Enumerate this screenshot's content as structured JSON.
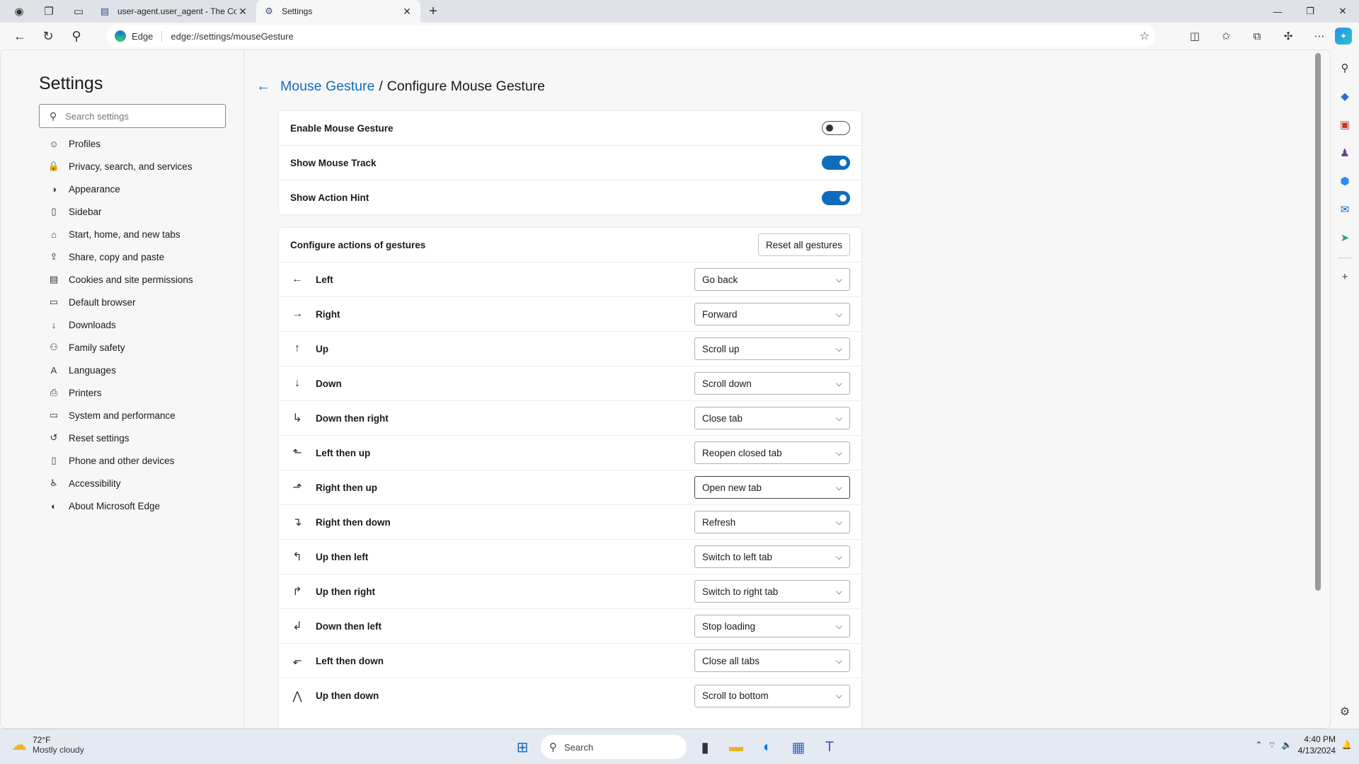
{
  "browser": {
    "tabs": [
      {
        "title": "user-agent.user_agent - The Coll",
        "active": false
      },
      {
        "title": "Settings",
        "active": true
      }
    ],
    "address": {
      "site_label": "Edge",
      "url": "edge://settings/mouseGesture"
    }
  },
  "sidebar": {
    "title": "Settings",
    "search_placeholder": "Search settings",
    "items": [
      {
        "label": "Profiles",
        "icon": "profile-icon"
      },
      {
        "label": "Privacy, search, and services",
        "icon": "lock-icon"
      },
      {
        "label": "Appearance",
        "icon": "appearance-icon"
      },
      {
        "label": "Sidebar",
        "icon": "sidebar-icon"
      },
      {
        "label": "Start, home, and new tabs",
        "icon": "home-icon"
      },
      {
        "label": "Share, copy and paste",
        "icon": "share-icon"
      },
      {
        "label": "Cookies and site permissions",
        "icon": "cookies-icon"
      },
      {
        "label": "Default browser",
        "icon": "browser-icon"
      },
      {
        "label": "Downloads",
        "icon": "download-icon"
      },
      {
        "label": "Family safety",
        "icon": "family-icon"
      },
      {
        "label": "Languages",
        "icon": "language-icon"
      },
      {
        "label": "Printers",
        "icon": "printer-icon"
      },
      {
        "label": "System and performance",
        "icon": "system-icon"
      },
      {
        "label": "Reset settings",
        "icon": "reset-icon"
      },
      {
        "label": "Phone and other devices",
        "icon": "phone-icon"
      },
      {
        "label": "Accessibility",
        "icon": "accessibility-icon"
      },
      {
        "label": "About Microsoft Edge",
        "icon": "edge-icon"
      }
    ]
  },
  "main": {
    "breadcrumb_link": "Mouse Gesture",
    "breadcrumb_sep": "/",
    "page_title": "Configure Mouse Gesture",
    "toggles": [
      {
        "label": "Enable Mouse Gesture",
        "on": false
      },
      {
        "label": "Show Mouse Track",
        "on": true
      },
      {
        "label": "Show Action Hint",
        "on": true
      }
    ],
    "gestures_header": "Configure actions of gestures",
    "reset_label": "Reset all gestures",
    "gestures": [
      {
        "name": "Left",
        "glyph": "←",
        "action": "Go back"
      },
      {
        "name": "Right",
        "glyph": "→",
        "action": "Forward"
      },
      {
        "name": "Up",
        "glyph": "↑",
        "action": "Scroll up"
      },
      {
        "name": "Down",
        "glyph": "↓",
        "action": "Scroll down"
      },
      {
        "name": "Down then right",
        "glyph": "↳",
        "action": "Close tab"
      },
      {
        "name": "Left then up",
        "glyph": "⬑",
        "action": "Reopen closed tab"
      },
      {
        "name": "Right then up",
        "glyph": "⬏",
        "action": "Open new tab"
      },
      {
        "name": "Right then down",
        "glyph": "↴",
        "action": "Refresh"
      },
      {
        "name": "Up then left",
        "glyph": "↰",
        "action": "Switch to left tab"
      },
      {
        "name": "Up then right",
        "glyph": "↱",
        "action": "Switch to right tab"
      },
      {
        "name": "Down then left",
        "glyph": "↲",
        "action": "Stop loading"
      },
      {
        "name": "Left then down",
        "glyph": "⬐",
        "action": "Close all tabs"
      },
      {
        "name": "Up then down",
        "glyph": "⋀",
        "action": "Scroll to bottom"
      }
    ]
  },
  "taskbar": {
    "weather_temp": "72°F",
    "weather_desc": "Mostly cloudy",
    "search_label": "Search",
    "time": "4:40 PM",
    "date": "4/13/2024"
  }
}
